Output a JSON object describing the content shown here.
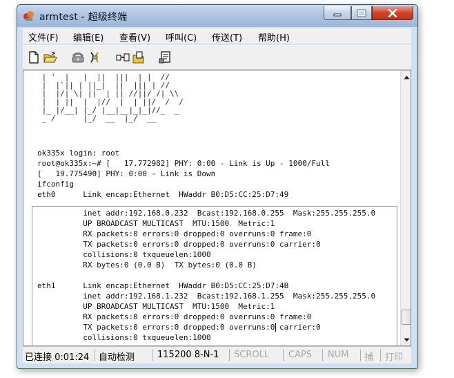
{
  "window": {
    "title": "armtest - 超级终端"
  },
  "menu": [
    "文件(F)",
    "编辑(E)",
    "查看(V)",
    "呼叫(C)",
    "传送(T)",
    "帮助(H)"
  ],
  "toolbar_icons": [
    "new-document-icon",
    "open-folder-icon",
    "call-phone-icon",
    "disconnect-icon",
    "send-receive-icon",
    "properties-icon"
  ],
  "terminal": {
    "banner": " | '  |   |  ||  |||  | |  //\n |  |`|| | ||_|  ||  ||| | // \n |  |/| \\| ||  | || //||/ /| \\\\\n |  | ||  |  |//  |  | ||/  /  /\n |_ |/__| |_/ |__|__|_|_|//_  _\n _ /      |_/  __  |_/  __    ",
    "upper_lines": [
      "ok335x login: root",
      "root@ok335x:~# [   17.772982] PHY: 0:00 - Link is Up - 1000/Full",
      "[   19.775490] PHY: 0:00 - Link is Down",
      "ifconfig",
      "eth0      Link encap:Ethernet  HWaddr B0:D5:CC:25:D7:49"
    ],
    "inner_lines": [
      "          inet addr:192.168.0.232  Bcast:192.168.0.255  Mask:255.255.255.0",
      "          UP BROADCAST MULTICAST  MTU:1500  Metric:1",
      "          RX packets:0 errors:0 dropped:0 overruns:0 frame:0",
      "          TX packets:0 errors:0 dropped:0 overruns:0 carrier:0",
      "          collisions:0 txqueuelen:1000",
      "          RX bytes:0 (0.0 B)  TX bytes:0 (0.0 B)",
      "",
      "eth1      Link encap:Ethernet  HWaddr B0:D5:CC:25:D7:4B",
      "          inet addr:192.168.1.232  Bcast:192.168.1.255  Mask:255.255.255.0",
      "          UP BROADCAST MULTICAST  MTU:1500  Metric:1",
      "          RX packets:0 errors:0 dropped:0 overruns:0 frame:0",
      "          TX packets:0 errors:0 dropped:0 overruns:0 carrier:0",
      "          collisions:0 txqueuelen:1000"
    ]
  },
  "status": {
    "connected": "已连接 0:01:24",
    "detect": "自动检测",
    "baud": "115200 8-N-1",
    "scroll": "SCROLL",
    "caps": "CAPS",
    "num": "NUM",
    "capture": "捕",
    "print": "打印"
  },
  "colors": {
    "title_bar": "#a9c1df",
    "close_button": "#d0452a",
    "dim_status": "#a8a8a8"
  }
}
